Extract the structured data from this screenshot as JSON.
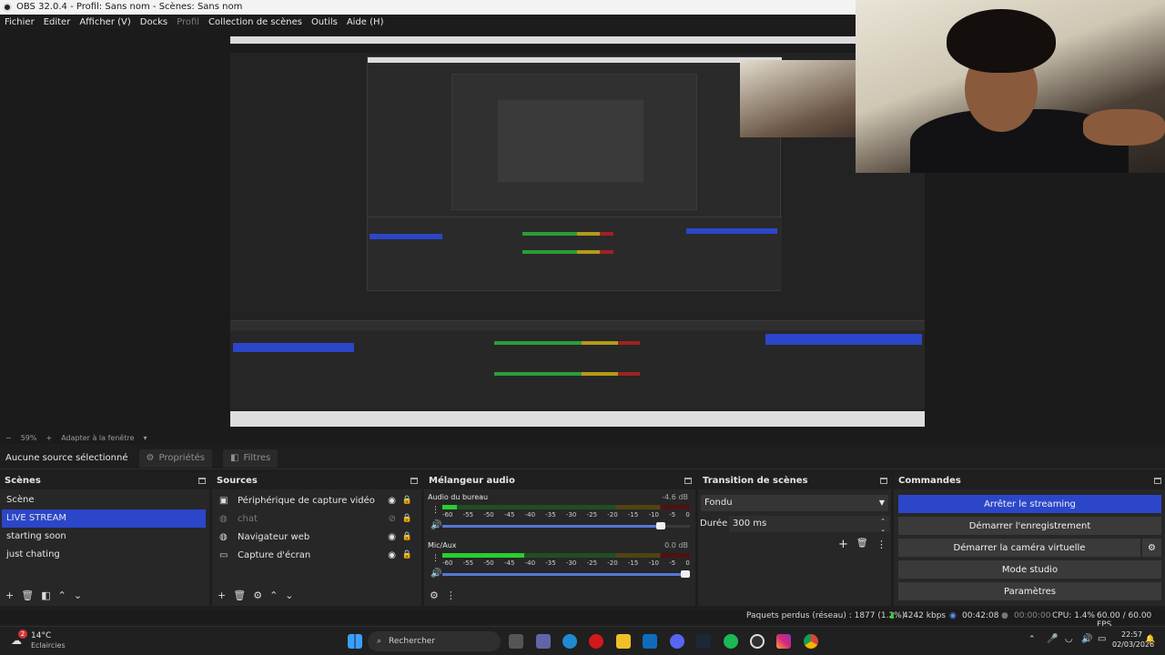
{
  "window": {
    "title": "OBS 32.0.4 - Profil: Sans nom - Scènes: Sans nom"
  },
  "menu": [
    {
      "label": "Fichier"
    },
    {
      "label": "Editer"
    },
    {
      "label": "Afficher (V)"
    },
    {
      "label": "Docks"
    },
    {
      "label": "Profil",
      "dim": true
    },
    {
      "label": "Collection de scènes"
    },
    {
      "label": "Outils"
    },
    {
      "label": "Aide (H)"
    }
  ],
  "zoom": {
    "level": "59%",
    "fit_label": "Adapter à la fenêtre"
  },
  "context": {
    "no_source": "Aucune source sélectionné",
    "properties": "Propriétés",
    "filters": "Filtres"
  },
  "scenes": {
    "title": "Scènes",
    "items": [
      "Scène",
      "LIVE STREAM",
      "starting soon",
      "just chating"
    ],
    "selected": "LIVE STREAM"
  },
  "sources": {
    "title": "Sources",
    "items": [
      {
        "label": "Périphérique de capture vidéo",
        "icon": "camera-icon",
        "visible": true
      },
      {
        "label": "chat",
        "icon": "globe-icon",
        "visible": false
      },
      {
        "label": "Navigateur web",
        "icon": "globe-icon",
        "visible": true
      },
      {
        "label": "Capture d'écran",
        "icon": "monitor-icon",
        "visible": true
      }
    ]
  },
  "mixer": {
    "title": "Mélangeur audio",
    "ticks": [
      "-60",
      "-55",
      "-50",
      "-45",
      "-40",
      "-35",
      "-30",
      "-25",
      "-20",
      "-15",
      "-10",
      "-5",
      "0"
    ],
    "channels": [
      {
        "name": "Audio du bureau",
        "db": "-4.6 dB",
        "level": 0.06,
        "volume": 0.9
      },
      {
        "name": "Mic/Aux",
        "db": "0.0 dB",
        "level": 0.33,
        "volume": 1.0
      }
    ]
  },
  "transitions": {
    "title": "Transition de scènes",
    "selected": "Fondu",
    "duration_label": "Durée",
    "duration_value": "300 ms"
  },
  "controls": {
    "title": "Commandes",
    "buttons": [
      {
        "label": "Arrêter le streaming",
        "active": true
      },
      {
        "label": "Démarrer l'enregistrement",
        "active": false
      },
      {
        "label": "Démarrer la caméra virtuelle",
        "active": false
      },
      {
        "label": "Mode studio",
        "active": false
      },
      {
        "label": "Paramètres",
        "active": false
      }
    ]
  },
  "status": {
    "dropped": "Paquets perdus (réseau) : 1877 (1.2%)",
    "bitrate": "4242 kbps",
    "stream_time": "00:42:08",
    "rec_time": "00:00:00",
    "cpu": "CPU: 1.4%",
    "fps": "60.00 / 60.00 FPS"
  },
  "taskbar": {
    "weather_temp": "14°C",
    "weather_desc": "Eclaircies",
    "weather_badge": "2",
    "search_placeholder": "Rechercher",
    "time": "22:57",
    "date": "02/03/2026"
  },
  "colors": {
    "accent": "#2c46c9",
    "meter_green": "#25d02d",
    "panel": "#272727"
  }
}
